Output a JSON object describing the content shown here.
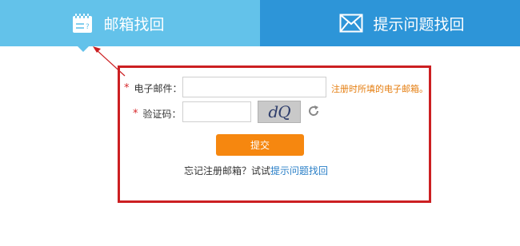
{
  "tabs": {
    "email": {
      "label": "邮箱找回"
    },
    "question": {
      "label": "提示问题找回"
    }
  },
  "form": {
    "email": {
      "star": "*",
      "label": "电子邮件：",
      "value": "",
      "hint": "注册时所填的电子邮箱。"
    },
    "captcha": {
      "star": "*",
      "label": "验证码：",
      "value": "",
      "image_text": "dQ"
    },
    "submit_label": "提交",
    "forgot_prefix": "忘记注册邮箱？试试",
    "forgot_link": "提示问题找回"
  },
  "colors": {
    "tab_active": "#63c2ea",
    "tab_inactive": "#2d95d8",
    "highlight_border": "#cc1f22",
    "submit": "#f6870f",
    "hint": "#e57e10",
    "link": "#2a7fc7"
  }
}
